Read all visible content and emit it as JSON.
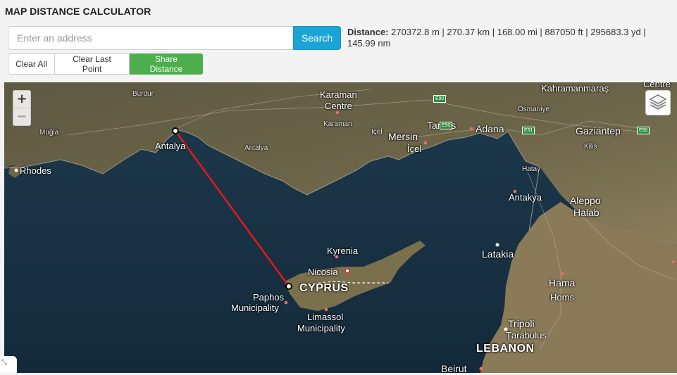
{
  "header": {
    "title": "MAP DISTANCE CALCULATOR",
    "search_placeholder": "Enter an address",
    "search_button": "Search",
    "distance_label": "Distance:",
    "distance_value": " 270372.8 m | 270.37 km | 168.00 mi | 887050 ft | 295683.3 yd | 145.99 nm"
  },
  "buttons": {
    "clear_all": "Clear All",
    "clear_last": "Clear Last Point",
    "share": "Share Distance"
  },
  "map": {
    "zoom_in": "+",
    "zoom_out": "−",
    "route_color": "#e8161b",
    "labels": {
      "burdur": "Burdur",
      "karaman_centre": "Karaman\nCentre",
      "karaman": "Karaman",
      "kahramanmaras": "Kahramanmaraş",
      "centre_edge": "Centre",
      "osmaniye": "Osmaniye",
      "mugla": "Muğla",
      "antalya": "Antalya",
      "antalya_province": "Antalya",
      "icel_small": "İçel",
      "mersin": "Mersin",
      "icel": "İçel",
      "tarsus": "Tarsus",
      "adana": "Adana",
      "gaziantep": "Gaziantep",
      "kilis": "Kilis",
      "rhodes": "Rhodes",
      "hatay": "Hatay",
      "antakya": "Antakya",
      "aleppo": "Aleppo",
      "halab": "Halab",
      "kyrenia": "Kyrenia",
      "latakia": "Latakia",
      "nicosia": "Nicosia",
      "cyprus": "CYPRUS",
      "paphos": "Paphos",
      "paphos_muni": "Municipality",
      "limassol": "Limassol",
      "limassol_muni": "Municipality",
      "hama": "Hama",
      "homs": "Homs",
      "tripoli": "Tripoli",
      "tarabulus": "Țarabulus",
      "lebanon": "LEBANON",
      "beirut": "Beirut"
    },
    "roads": [
      "E90",
      "E90",
      "E91",
      "E90"
    ]
  },
  "footer": {
    "corner_glyph": "⤡"
  }
}
